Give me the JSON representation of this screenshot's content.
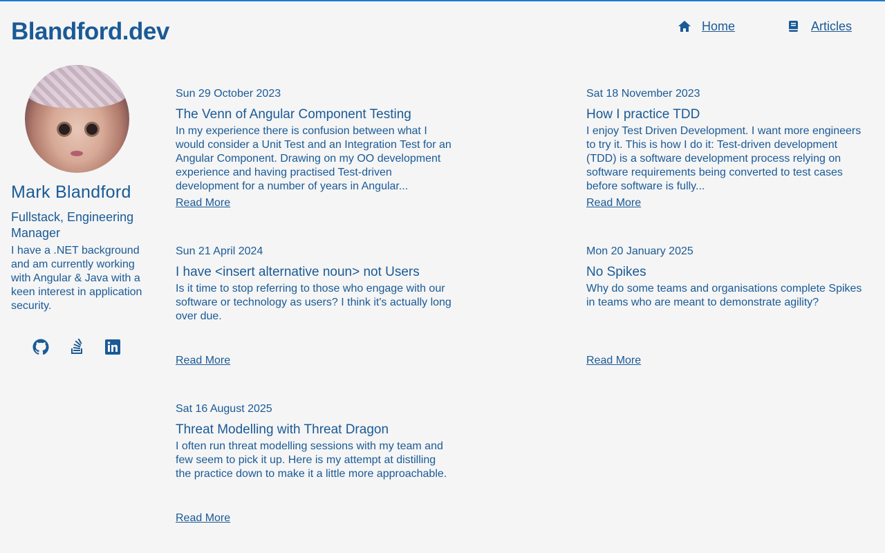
{
  "site": {
    "title": "Blandford.dev"
  },
  "nav": {
    "home": {
      "label": "Home",
      "icon": "home-icon"
    },
    "articles": {
      "label": "Articles",
      "icon": "book-icon"
    }
  },
  "profile": {
    "name": "Mark Blandford",
    "role": "Fullstack, Engineering Manager",
    "bio": "I have a .NET background and am currently working with Angular & Java with a keen interest in application security.",
    "socials": [
      {
        "icon": "github-icon"
      },
      {
        "icon": "stackoverflow-icon"
      },
      {
        "icon": "linkedin-icon"
      }
    ]
  },
  "articles": [
    {
      "date": "Sun 29 October 2023",
      "title": "The Venn of Angular Component Testing",
      "summary": "In my experience there is confusion between what I would consider a Unit Test and an Integration Test for an Angular Component. Drawing on my OO development experience and having practised Test-driven development for a number of years in Angular...",
      "link": "Read More"
    },
    {
      "date": "Sat 18 November 2023",
      "title": "How I practice TDD",
      "summary": "I enjoy Test Driven Development. I want more engineers to try it. This is how I do it: Test-driven development (TDD) is a software development process relying on software requirements being converted to test cases before software is fully...",
      "link": "Read More"
    },
    {
      "date": "Sun 21 April 2024",
      "title": "I have <insert alternative noun> not Users",
      "summary": "Is it time to stop referring to those who engage with our software or technology as users? I think it's actually long over due.",
      "link": "Read More"
    },
    {
      "date": "Mon 20 January 2025",
      "title": "No Spikes",
      "summary": "Why do some teams and organisations complete Spikes in teams who are meant to demonstrate agility?",
      "link": "Read More"
    },
    {
      "date": "Sat 16 August 2025",
      "title": "Threat Modelling with Threat Dragon",
      "summary": "I often run threat modelling sessions with my team and few seem to pick it up. Here is my attempt at distilling the practice down to make it a little more approachable.",
      "link": "Read More"
    }
  ]
}
